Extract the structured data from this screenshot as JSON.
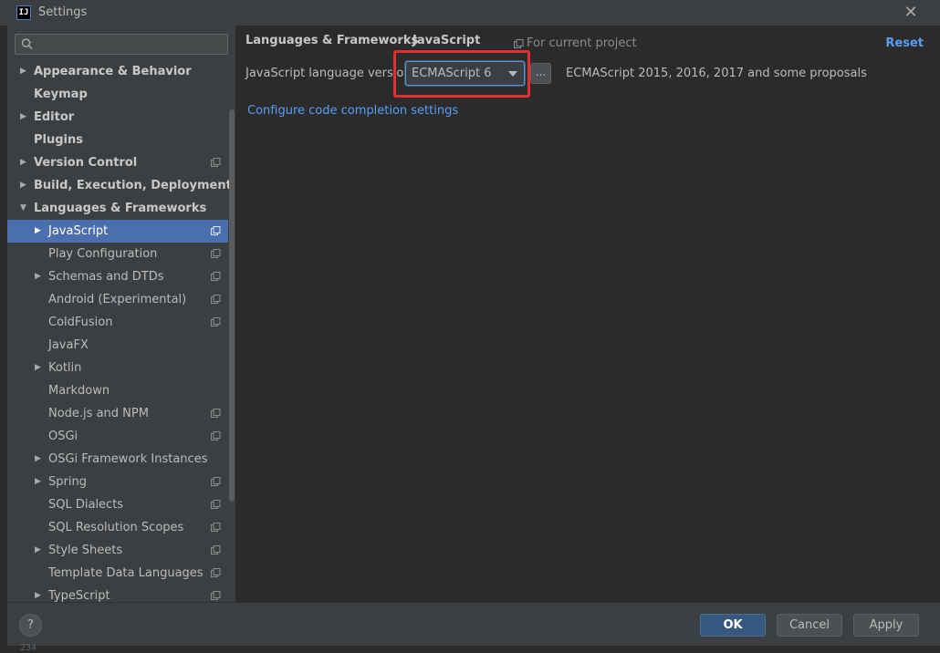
{
  "window": {
    "title": "Settings",
    "app_icon_text": "IJ",
    "close_glyph": "✕"
  },
  "search": {
    "placeholder": ""
  },
  "tree": {
    "items": [
      {
        "label": "Appearance & Behavior",
        "bold": true,
        "arrow": "right",
        "level": 0,
        "project_icon": false
      },
      {
        "label": "Keymap",
        "bold": true,
        "arrow": "none",
        "level": 0,
        "project_icon": false
      },
      {
        "label": "Editor",
        "bold": true,
        "arrow": "right",
        "level": 0,
        "project_icon": false
      },
      {
        "label": "Plugins",
        "bold": true,
        "arrow": "none",
        "level": 0,
        "project_icon": false
      },
      {
        "label": "Version Control",
        "bold": true,
        "arrow": "right",
        "level": 0,
        "project_icon": true
      },
      {
        "label": "Build, Execution, Deployment",
        "bold": true,
        "arrow": "right",
        "level": 0,
        "project_icon": false
      },
      {
        "label": "Languages & Frameworks",
        "bold": true,
        "arrow": "down",
        "level": 0,
        "project_icon": false
      },
      {
        "label": "JavaScript",
        "bold": false,
        "arrow": "right",
        "level": 1,
        "project_icon": true,
        "selected": true
      },
      {
        "label": "Play Configuration",
        "bold": false,
        "arrow": "none",
        "level": 1,
        "project_icon": true
      },
      {
        "label": "Schemas and DTDs",
        "bold": false,
        "arrow": "right",
        "level": 1,
        "project_icon": true
      },
      {
        "label": "Android (Experimental)",
        "bold": false,
        "arrow": "none",
        "level": 1,
        "project_icon": true
      },
      {
        "label": "ColdFusion",
        "bold": false,
        "arrow": "none",
        "level": 1,
        "project_icon": true
      },
      {
        "label": "JavaFX",
        "bold": false,
        "arrow": "none",
        "level": 1,
        "project_icon": false
      },
      {
        "label": "Kotlin",
        "bold": false,
        "arrow": "right",
        "level": 1,
        "project_icon": false
      },
      {
        "label": "Markdown",
        "bold": false,
        "arrow": "none",
        "level": 1,
        "project_icon": false
      },
      {
        "label": "Node.js and NPM",
        "bold": false,
        "arrow": "none",
        "level": 1,
        "project_icon": true
      },
      {
        "label": "OSGi",
        "bold": false,
        "arrow": "none",
        "level": 1,
        "project_icon": true
      },
      {
        "label": "OSGi Framework Instances",
        "bold": false,
        "arrow": "right",
        "level": 1,
        "project_icon": false
      },
      {
        "label": "Spring",
        "bold": false,
        "arrow": "right",
        "level": 1,
        "project_icon": true
      },
      {
        "label": "SQL Dialects",
        "bold": false,
        "arrow": "none",
        "level": 1,
        "project_icon": true
      },
      {
        "label": "SQL Resolution Scopes",
        "bold": false,
        "arrow": "none",
        "level": 1,
        "project_icon": true
      },
      {
        "label": "Style Sheets",
        "bold": false,
        "arrow": "right",
        "level": 1,
        "project_icon": true
      },
      {
        "label": "Template Data Languages",
        "bold": false,
        "arrow": "none",
        "level": 1,
        "project_icon": true
      },
      {
        "label": "TypeScript",
        "bold": false,
        "arrow": "right",
        "level": 1,
        "project_icon": true
      }
    ]
  },
  "main": {
    "breadcrumb_parent": "Languages & Frameworks",
    "breadcrumb_separator": "›",
    "breadcrumb_current": "JavaScript",
    "for_project": "For current project",
    "reset": "Reset",
    "language_version_label": "JavaScript language version",
    "language_version_value": "ECMAScript 6",
    "more_button": "...",
    "language_version_description": "ECMAScript 2015, 2016, 2017 and some proposals",
    "configure_link": "Configure code completion settings"
  },
  "buttons": {
    "help": "?",
    "ok": "OK",
    "cancel": "Cancel",
    "apply": "Apply"
  },
  "status": {
    "line_number": "234"
  },
  "colors": {
    "selection": "#4b6eaf",
    "link": "#589df6",
    "highlight_border": "#e62e2e",
    "ok_button": "#365880"
  }
}
